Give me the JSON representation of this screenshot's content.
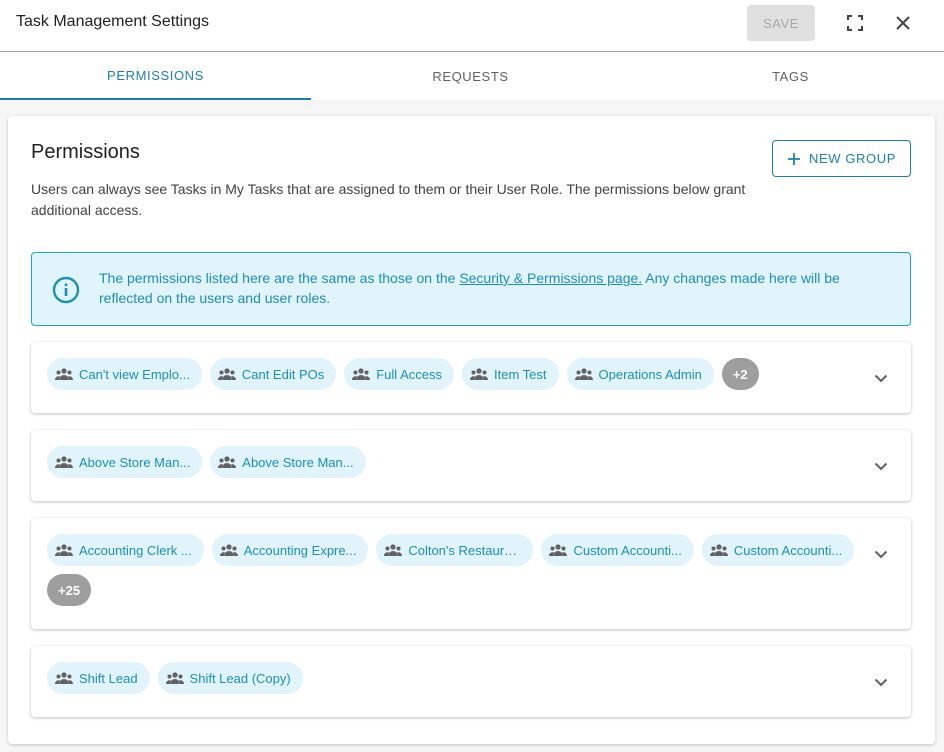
{
  "header": {
    "title": "Task Management Settings",
    "save_label": "SAVE"
  },
  "tabs": [
    {
      "label": "PERMISSIONS",
      "active": true
    },
    {
      "label": "REQUESTS",
      "active": false
    },
    {
      "label": "TAGS",
      "active": false
    }
  ],
  "permissions": {
    "title": "Permissions",
    "description": "Users can always see Tasks in My Tasks that are assigned to them or their User Role. The permissions below grant additional access.",
    "new_group_label": "NEW GROUP"
  },
  "info_banner": {
    "text_before": "The permissions listed here are the same as those on the ",
    "link_text": "Security & Permissions page.",
    "text_after": " Any changes made here will be reflected on the users and user roles."
  },
  "groups": [
    {
      "chips": [
        "Can't view Emplo...",
        "Cant Edit POs",
        "Full Access",
        "Item Test",
        "Operations Admin"
      ],
      "more": "+2"
    },
    {
      "chips": [
        "Above Store Man...",
        "Above Store Man..."
      ],
      "more": null
    },
    {
      "chips": [
        "Accounting Clerk ...",
        "Accounting Expre...",
        "Colton's Restaura...",
        "Custom Accounti...",
        "Custom Accounti..."
      ],
      "more": "+25"
    },
    {
      "chips": [
        "Shift Lead",
        "Shift Lead (Copy)"
      ],
      "more": null
    }
  ],
  "colors": {
    "accent": "#1a7fb0",
    "chip_bg": "#e1f4fb",
    "chip_text": "#1a8fb8",
    "more_chip_bg": "#9e9e9e"
  },
  "icons": {
    "fullscreen": "fullscreen-icon",
    "close": "close-icon",
    "info": "info-icon",
    "chip": "group-icon",
    "expand": "chevron-down-icon",
    "add": "plus-icon"
  }
}
